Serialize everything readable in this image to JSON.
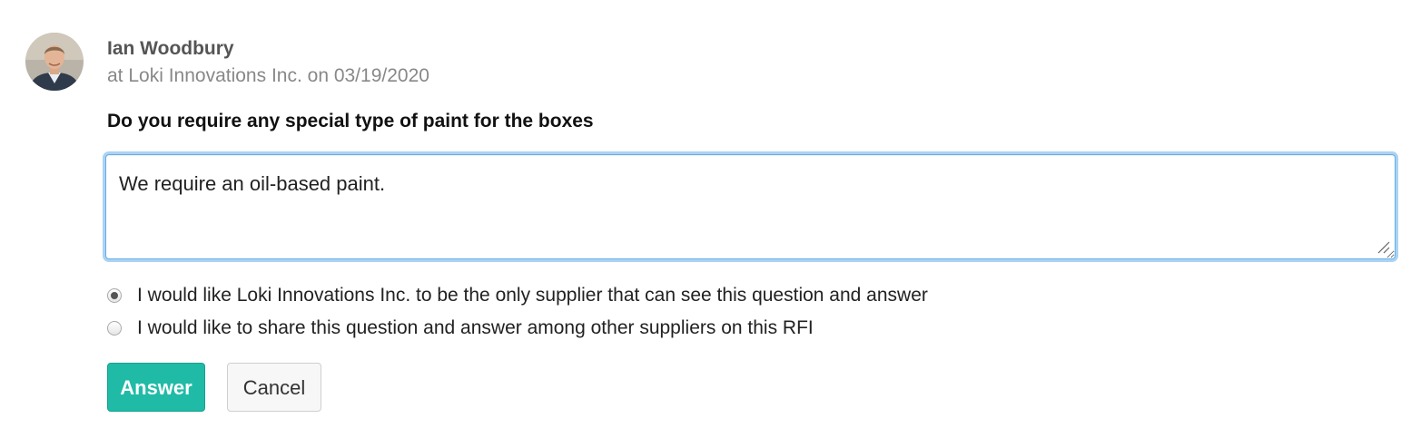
{
  "author": {
    "name": "Ian Woodbury",
    "meta": "at Loki Innovations Inc. on 03/19/2020",
    "avatar_icon": "person-avatar-icon"
  },
  "question": {
    "text": "Do you require any special type of paint for the boxes"
  },
  "answer_field": {
    "value": "We require an oil-based paint.",
    "placeholder": ""
  },
  "visibility_options": [
    {
      "label": "I would like Loki Innovations Inc. to be the only supplier that can see this question and answer",
      "selected": true
    },
    {
      "label": "I would like to share this question and answer among other suppliers on this RFI",
      "selected": false
    }
  ],
  "actions": {
    "answer_label": "Answer",
    "cancel_label": "Cancel"
  },
  "colors": {
    "accent": "#1fbba6",
    "focus_ring": "#66afe9"
  }
}
